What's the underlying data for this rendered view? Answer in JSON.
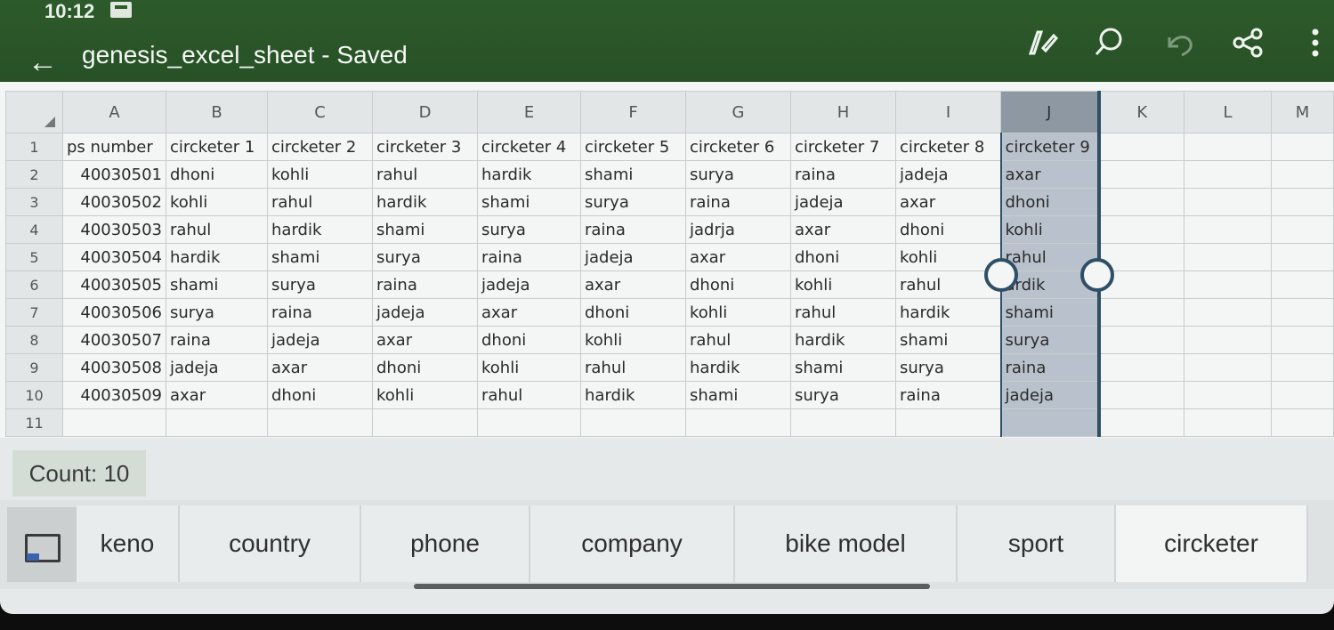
{
  "status": {
    "time": "10:12"
  },
  "appbar": {
    "title": "genesis_excel_sheet - Saved",
    "icons": [
      "back-arrow-icon",
      "edit-pen-icon",
      "search-icon",
      "undo-icon",
      "share-icon",
      "more-vert-icon"
    ]
  },
  "sheet": {
    "columns": [
      "A",
      "B",
      "C",
      "D",
      "E",
      "F",
      "G",
      "H",
      "I",
      "J",
      "K",
      "L",
      "M"
    ],
    "row_numbers": [
      "1",
      "2",
      "3",
      "4",
      "5",
      "6",
      "7",
      "8",
      "9",
      "10",
      "11"
    ],
    "selected_column": "J",
    "rows": [
      [
        "ps number",
        "circketer 1",
        "circketer 2",
        "circketer 3",
        "circketer 4",
        "circketer 5",
        "circketer 6",
        "circketer 7",
        "circketer 8",
        "circketer 9",
        "",
        "",
        ""
      ],
      [
        "40030501",
        "dhoni",
        "kohli",
        "rahul",
        "hardik",
        "shami",
        "surya",
        "raina",
        "jadeja",
        "axar",
        "",
        "",
        ""
      ],
      [
        "40030502",
        "kohli",
        "rahul",
        "hardik",
        "shami",
        "surya",
        "raina",
        "jadeja",
        "axar",
        "dhoni",
        "",
        "",
        ""
      ],
      [
        "40030503",
        "rahul",
        "hardik",
        "shami",
        "surya",
        "raina",
        "jadrja",
        "axar",
        "dhoni",
        "kohli",
        "",
        "",
        ""
      ],
      [
        "40030504",
        "hardik",
        "shami",
        "surya",
        "raina",
        "jadeja",
        "axar",
        "dhoni",
        "kohli",
        "rahul",
        "",
        "",
        ""
      ],
      [
        "40030505",
        "shami",
        "surya",
        "raina",
        "jadeja",
        "axar",
        "dhoni",
        "kohli",
        "rahul",
        "ardik",
        "",
        "",
        ""
      ],
      [
        "40030506",
        "surya",
        "raina",
        "jadeja",
        "axar",
        "dhoni",
        "kohli",
        "rahul",
        "hardik",
        "shami",
        "",
        "",
        ""
      ],
      [
        "40030507",
        "raina",
        "jadeja",
        "axar",
        "dhoni",
        "kohli",
        "rahul",
        "hardik",
        "shami",
        "surya",
        "",
        "",
        ""
      ],
      [
        "40030508",
        "jadeja",
        "axar",
        "dhoni",
        "kohli",
        "rahul",
        "hardik",
        "shami",
        "surya",
        "raina",
        "",
        "",
        ""
      ],
      [
        "40030509",
        "axar",
        "dhoni",
        "kohli",
        "rahul",
        "hardik",
        "shami",
        "surya",
        "raina",
        "jadeja",
        "",
        "",
        ""
      ],
      [
        "",
        "",
        "",
        "",
        "",
        "",
        "",
        "",
        "",
        "",
        "",
        "",
        ""
      ]
    ]
  },
  "count": {
    "label": "Count: 10"
  },
  "tabs": [
    "keno",
    "country",
    "phone",
    "company",
    "bike model",
    "sport",
    "circketer"
  ],
  "colors": {
    "appbar": "#2d5a2b",
    "selection": "#2f4f67"
  }
}
